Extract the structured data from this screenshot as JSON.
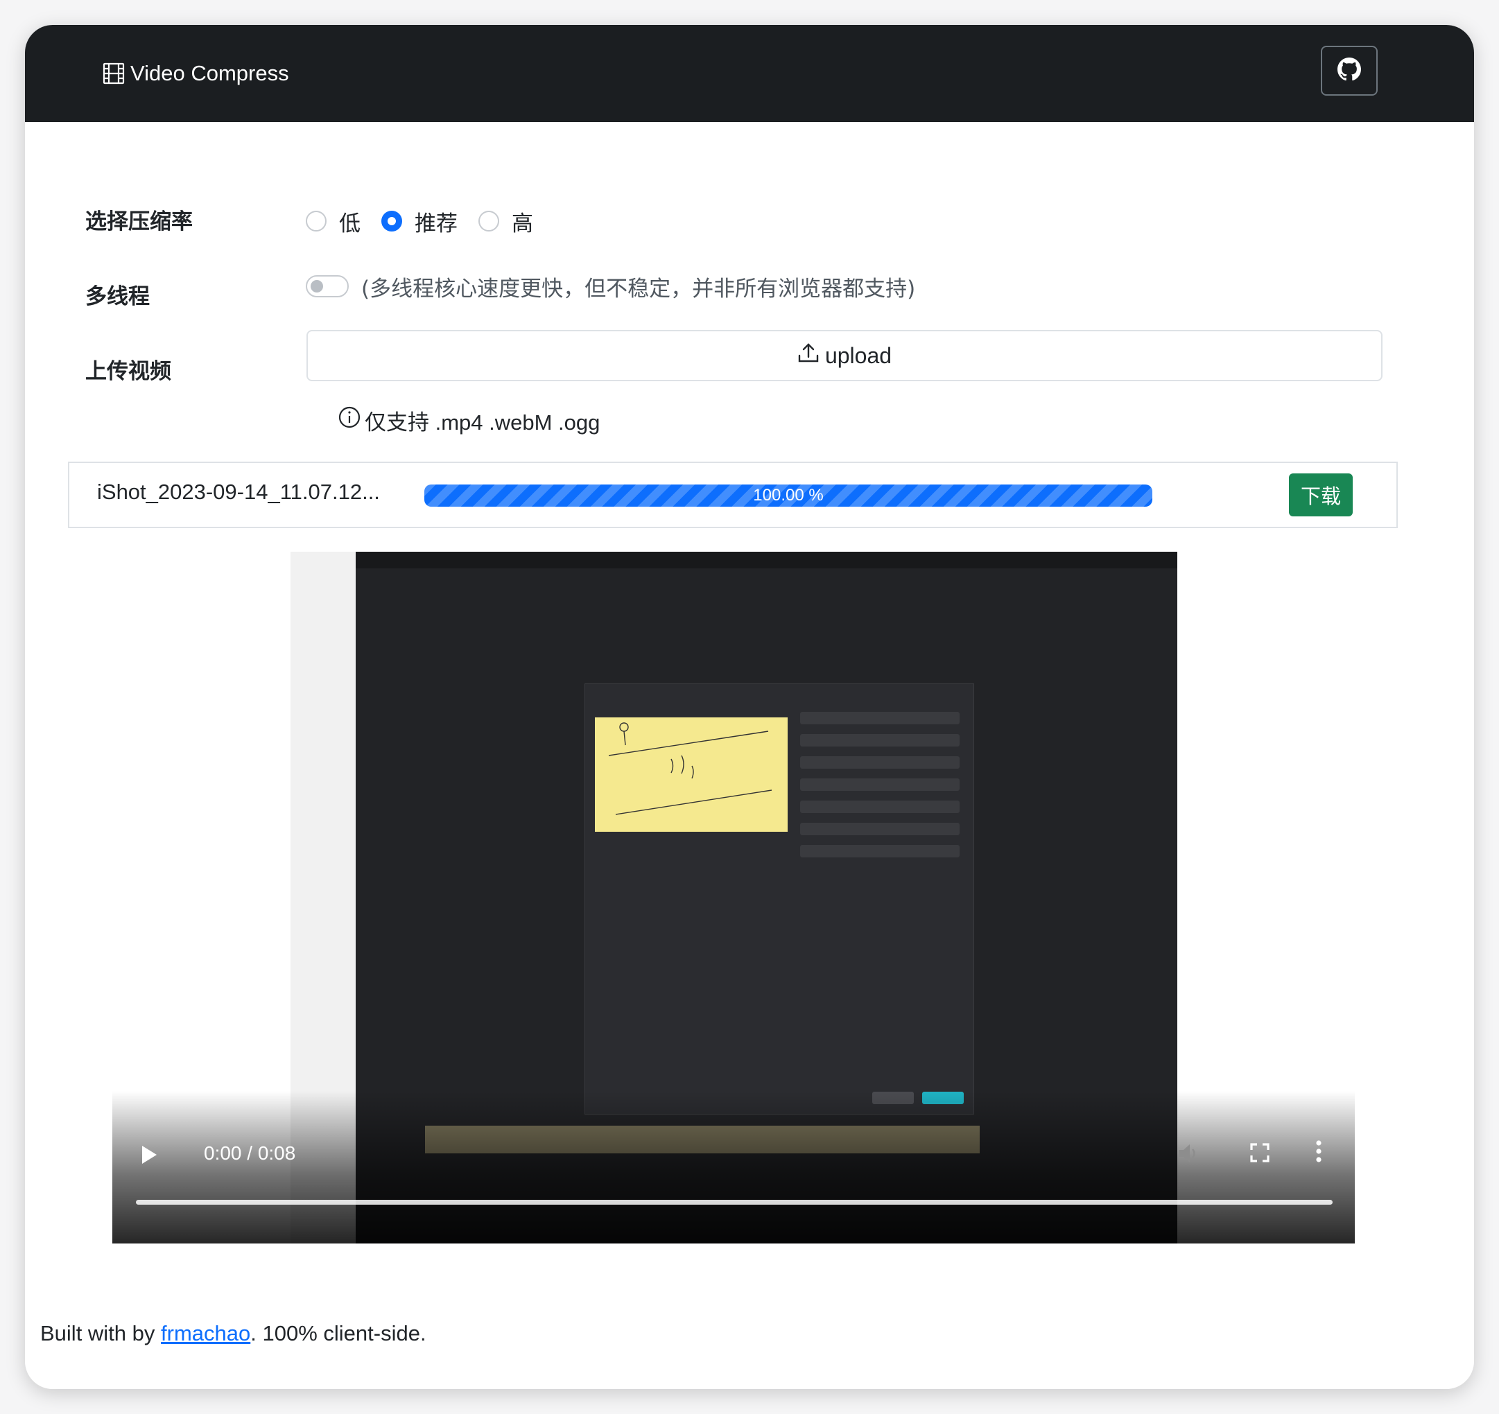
{
  "header": {
    "brand": "Video Compress",
    "brand_icon": "film-icon",
    "github_icon": "github-icon"
  },
  "form": {
    "compression": {
      "label": "选择压缩率",
      "options": [
        "低",
        "推荐",
        "高"
      ],
      "selected": "推荐"
    },
    "multithread": {
      "label": "多线程",
      "enabled": false,
      "note": "(多线程核心速度更快，但不稳定，并非所有浏览器都支持)"
    },
    "upload": {
      "label": "上传视频",
      "button_label": "upload",
      "hint": "仅支持 .mp4 .webM .ogg"
    }
  },
  "task": {
    "file_name": "iShot_2023-09-14_11.07.12...",
    "progress_percent": 100,
    "progress_text": "100.00 %",
    "download_label": "下载"
  },
  "video": {
    "time": "0:00 / 0:08",
    "controls": [
      "play-icon",
      "volume-icon",
      "fullscreen-icon",
      "more-options-icon"
    ]
  },
  "footer": {
    "prefix": "Built with by",
    "author": "frmachao",
    "suffix": ". 100% client-side."
  },
  "colors": {
    "navbar": "#1b1e21",
    "primary": "#0d6efd",
    "success": "#198754"
  }
}
